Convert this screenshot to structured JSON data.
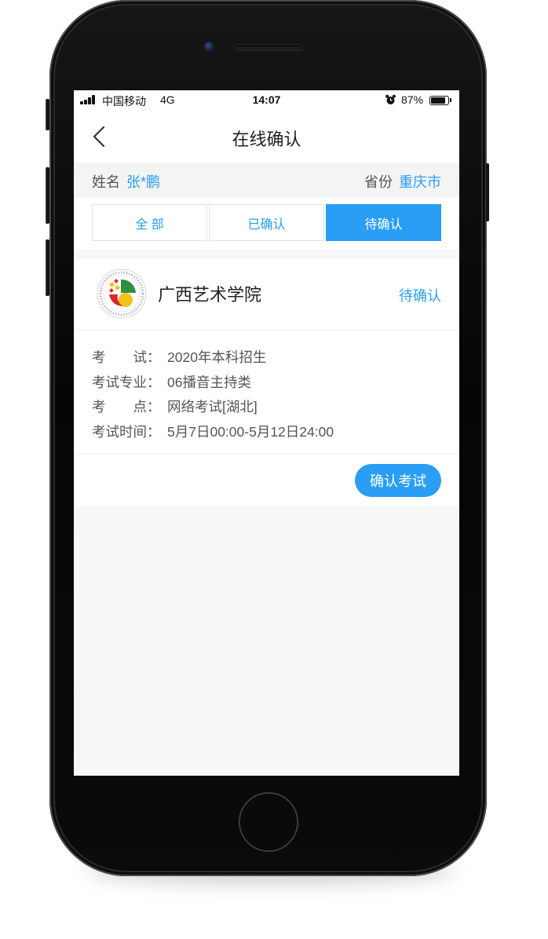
{
  "status_bar": {
    "carrier": "中国移动",
    "network": "4G",
    "time": "14:07",
    "battery": "87%",
    "battery_level": 0.87,
    "icons": [
      "signal-icon",
      "alarm-icon",
      "battery-icon"
    ]
  },
  "nav": {
    "title": "在线确认",
    "back_icon": "chevron-left-icon"
  },
  "info": {
    "name_label": "姓名",
    "name_value": "张*鹏",
    "province_label": "省份",
    "province_value": "重庆市"
  },
  "tabs": {
    "items": [
      {
        "label": "全 部"
      },
      {
        "label": "已确认"
      },
      {
        "label": "待确认"
      }
    ],
    "active_index": 2
  },
  "card": {
    "school": "广西艺术学院",
    "logo_icon": "school-logo",
    "status": "待确认",
    "details": [
      {
        "label": "考　　试：",
        "value": "2020年本科招生"
      },
      {
        "label": "考试专业：",
        "value": "06播音主持类"
      },
      {
        "label": "考　　点：",
        "value": "网络考试[湖北]"
      },
      {
        "label": "考试时间：",
        "value": "5月7日00:00-5月12日24:00"
      }
    ],
    "confirm_button": "确认考试"
  },
  "colors": {
    "accent": "#2a9ef5",
    "text": "#222222",
    "secondary_text": "#555555",
    "page_background": "#f7f7f7"
  }
}
